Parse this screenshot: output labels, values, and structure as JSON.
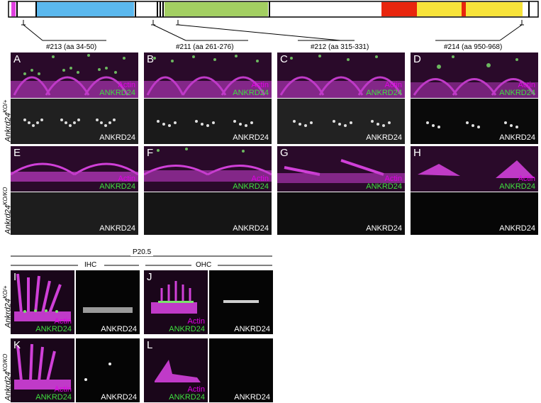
{
  "peptides": [
    {
      "label": "#213 (aa 34-50)"
    },
    {
      "label": "#211 (aa 261-276)"
    },
    {
      "label": "#212 (aa 315-331)"
    },
    {
      "label": "#214 (aa 950-968)"
    }
  ],
  "domain_colors": {
    "magenta": "#e040e0",
    "blue": "#5bb8ee",
    "green": "#a3cf62",
    "red": "#e8260e",
    "yellow": "#f7e33a"
  },
  "top_panels": [
    "A",
    "B",
    "C",
    "D"
  ],
  "mid_panels": [
    "E",
    "F",
    "G",
    "H"
  ],
  "row_labels": {
    "het_base": "Ankrd24",
    "het_sup": "KO/+",
    "ko_base": "Ankrd24",
    "ko_sup": "KO/KO"
  },
  "channel_labels": {
    "actin": "Actin",
    "ankrd24": "ANKRD24"
  },
  "bottom": {
    "age": "P20.5",
    "ihc": "IHC",
    "ohc": "OHC",
    "panels": [
      "I",
      "J",
      "K",
      "L"
    ]
  }
}
